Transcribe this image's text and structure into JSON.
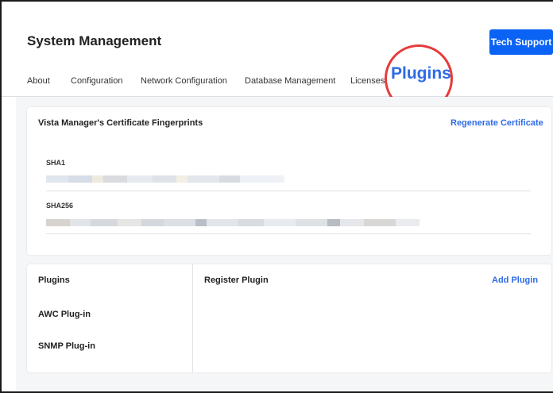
{
  "page": {
    "title": "System Management",
    "tech_support_label": "Tech Support"
  },
  "tabs": [
    {
      "label": "About"
    },
    {
      "label": "Configuration"
    },
    {
      "label": "Network Configuration"
    },
    {
      "label": "Database Management"
    },
    {
      "label": "Licenses"
    },
    {
      "label": "Plugins",
      "active": true
    }
  ],
  "certificate": {
    "title": "Vista Manager's Certificate Fingerprints",
    "regenerate_label": "Regenerate Certificate",
    "sha1_label": "SHA1",
    "sha256_label": "SHA256"
  },
  "plugins_panel": {
    "title": "Plugins",
    "items": [
      {
        "label": "AWC Plug-in"
      },
      {
        "label": "SNMP Plug-in"
      }
    ]
  },
  "register_panel": {
    "title": "Register Plugin",
    "add_label": "Add Plugin"
  },
  "colors": {
    "accent": "#2e6be6",
    "button": "#0b63f5",
    "highlight": "#e53b3b"
  }
}
